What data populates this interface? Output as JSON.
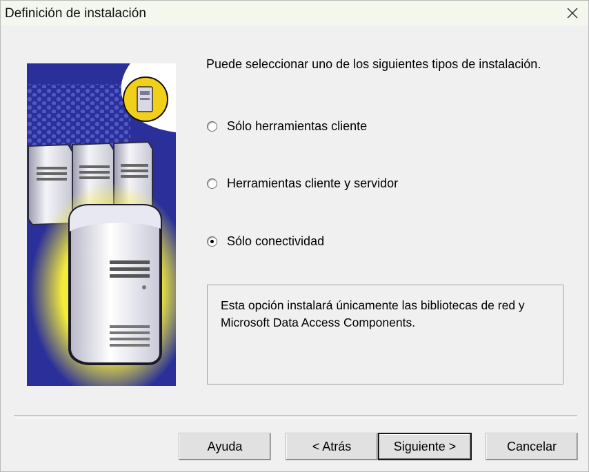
{
  "window": {
    "title": "Definición de instalación"
  },
  "main": {
    "prompt": "Puede seleccionar uno de los siguientes tipos de instalación.",
    "options": [
      {
        "label": "Sólo herramientas cliente",
        "checked": false
      },
      {
        "label": "Herramientas cliente y servidor",
        "checked": false
      },
      {
        "label": "Sólo conectividad",
        "checked": true
      }
    ],
    "description_lines": [
      "Esta opción instalará únicamente las bibliotecas de red y",
      "Microsoft Data Access Components."
    ]
  },
  "buttons": {
    "help": "Ayuda",
    "back": "< Atrás",
    "next": "Siguiente >",
    "cancel": "Cancelar"
  },
  "colors": {
    "art_background": "#2a2f9a",
    "glow": "#f4ec3a",
    "badge": "#f1cf1a"
  },
  "icons": {
    "close": "close-icon",
    "art": "server-illustration",
    "badge": "computer-badge-icon"
  }
}
